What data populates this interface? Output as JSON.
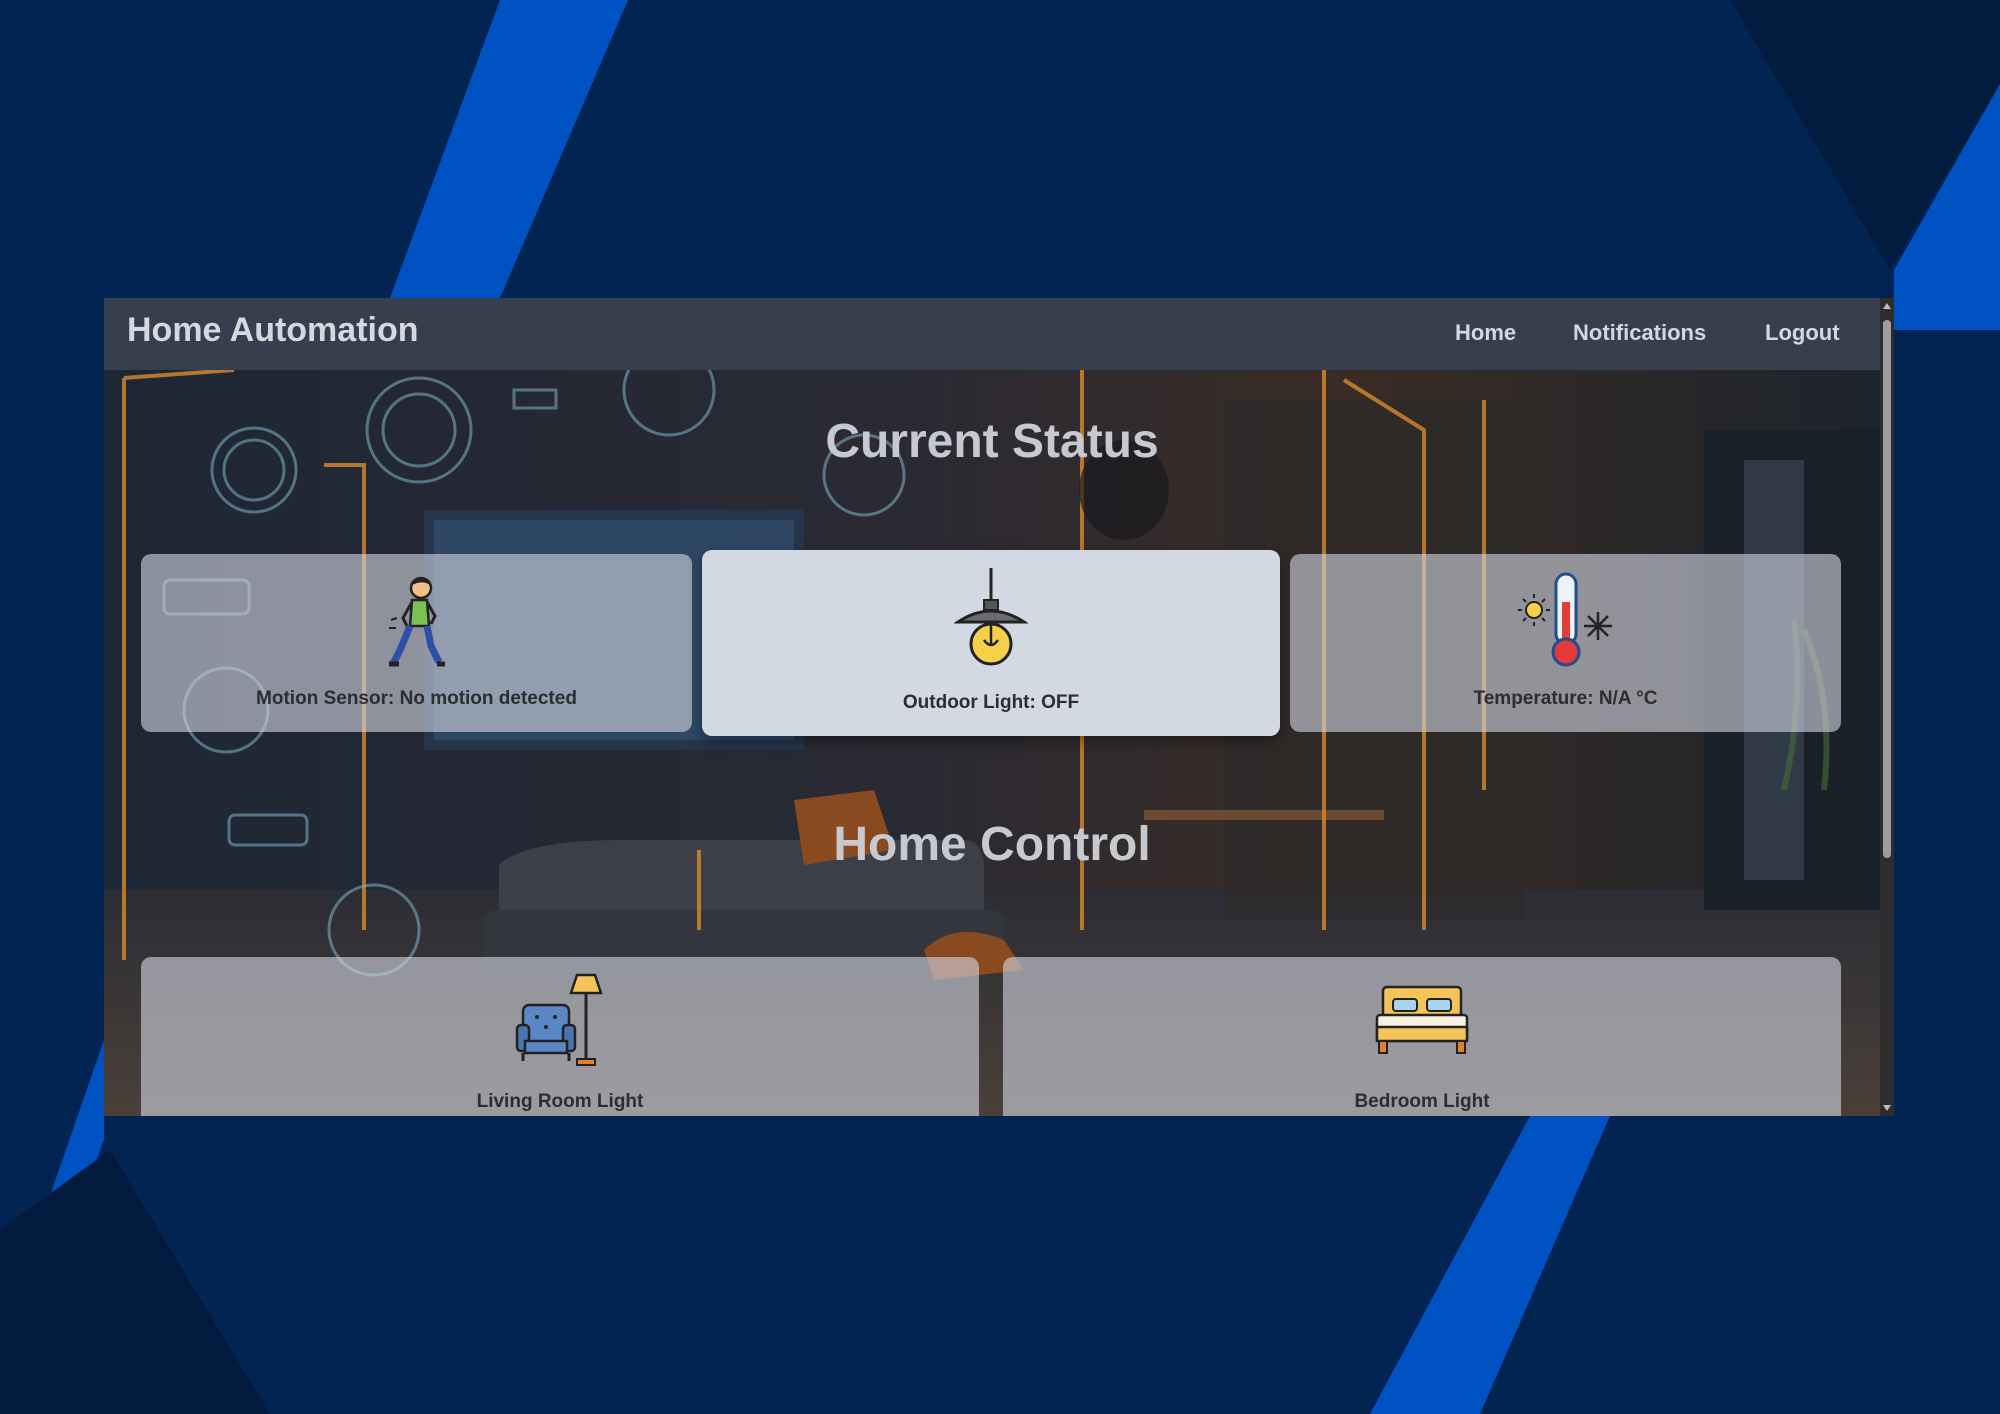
{
  "app": {
    "title": "Home Automation"
  },
  "nav": {
    "home": "Home",
    "notifications": "Notifications",
    "logout": "Logout"
  },
  "status": {
    "title": "Current Status",
    "motion_label": "Motion Sensor: No motion detected",
    "light_label": "Outdoor Light: OFF",
    "temperature_label": "Temperature: N/A °C"
  },
  "control": {
    "title": "Home Control",
    "living_room_label": "Living Room Light",
    "bedroom_label": "Bedroom Light"
  },
  "icons": {
    "motion": "walking-person-icon",
    "light": "hanging-lamp-icon",
    "temperature": "thermometer-icon",
    "living_room": "armchair-lamp-icon",
    "bedroom": "bed-icon"
  },
  "colors": {
    "page_background": "#012453",
    "accent_blue": "#0052c2",
    "navbar": "#363f4e",
    "card": "#d0d4de",
    "card_text": "#2b2d31"
  }
}
